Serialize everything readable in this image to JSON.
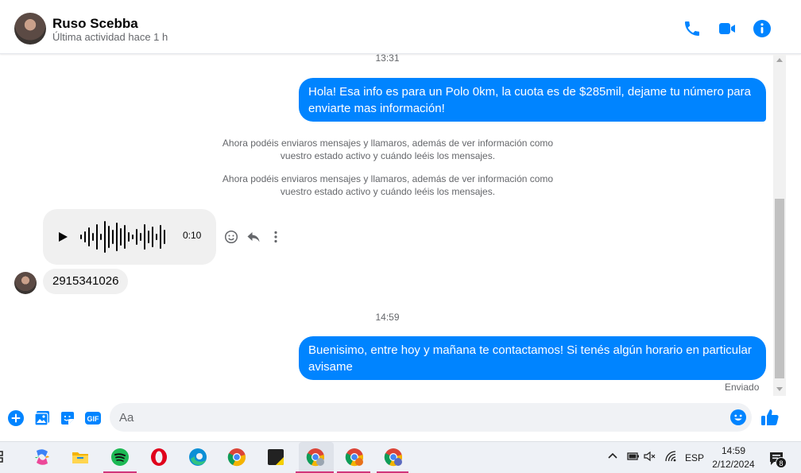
{
  "header": {
    "contact_name": "Ruso Scebba",
    "status": "Última actividad hace 1 h",
    "actions": [
      "phone-icon",
      "video-icon",
      "info-icon"
    ],
    "accent_color": "#0084ff"
  },
  "conversation": {
    "timestamp_1": "13:31",
    "message_1": "Hola! Esa info es para un Polo 0km, la cuota es de $285mil, dejame tu número para enviarte mas información!",
    "system_notice_1": "Ahora podéis enviaros mensajes y llamaros, además de ver información como vuestro estado activo y cuándo leéis los mensajes.",
    "system_notice_2": "Ahora podéis enviaros mensajes y llamaros, además de ver información como vuestro estado activo y cuándo leéis los mensajes.",
    "voice_message": {
      "duration": "0:10"
    },
    "incoming_message": "2915341026",
    "timestamp_2": "14:59",
    "message_2": "Buenisimo, entre hoy y mañana te contactamos! Si tenés algún horario en particular avisame",
    "delivery_status": "Enviado"
  },
  "composer": {
    "placeholder": "Aa",
    "value": "",
    "icons": [
      "plus-icon",
      "image-icon",
      "sticker-icon",
      "gif-icon",
      "emoji-icon",
      "thumbs-up-icon"
    ],
    "gif_label": "GIF"
  },
  "taskbar": {
    "apps": [
      "task-view-icon",
      "copilot-icon",
      "file-explorer-icon",
      "spotify-icon",
      "opera-icon",
      "edge-icon",
      "chrome-icon",
      "sticky-notes-icon",
      "chrome-profile-y-icon",
      "chrome-profile-r-icon",
      "chrome-profile-c-icon"
    ],
    "language": "ESP",
    "time": "14:59",
    "date": "2/12/2024",
    "notification_count": "8"
  }
}
